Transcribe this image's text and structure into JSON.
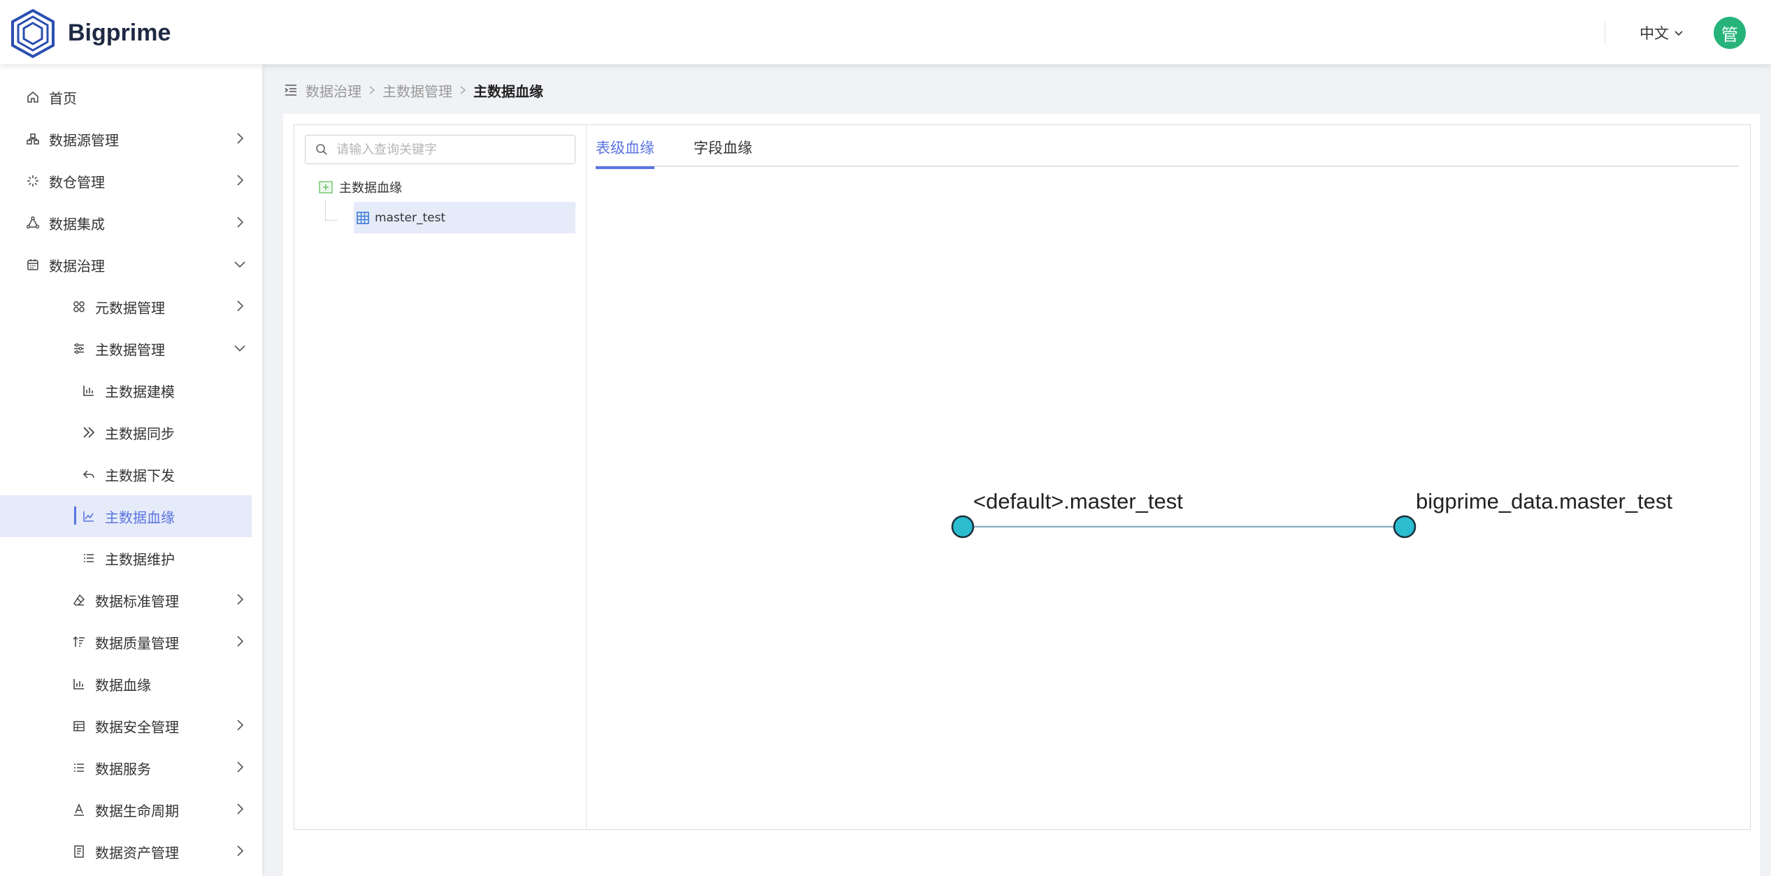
{
  "app": {
    "name": "Bigprime"
  },
  "header": {
    "language": "中文",
    "avatar_text": "管"
  },
  "sidebar": {
    "items": [
      {
        "label": "首页",
        "icon": "home-icon"
      },
      {
        "label": "数据源管理",
        "icon": "datasource-icon"
      },
      {
        "label": "数仓管理",
        "icon": "warehouse-icon"
      },
      {
        "label": "数据集成",
        "icon": "integration-icon"
      },
      {
        "label": "数据治理",
        "icon": "governance-icon"
      },
      {
        "label": "元数据管理",
        "icon": "metadata-icon"
      },
      {
        "label": "主数据管理",
        "icon": "masterdata-icon"
      },
      {
        "label": "主数据建模",
        "icon": "bar-chart-icon"
      },
      {
        "label": "主数据同步",
        "icon": "double-chevron-icon"
      },
      {
        "label": "主数据下发",
        "icon": "reply-icon"
      },
      {
        "label": "主数据血缘",
        "icon": "line-chart-icon"
      },
      {
        "label": "主数据维护",
        "icon": "list-icon"
      },
      {
        "label": "数据标准管理",
        "icon": "eraser-icon"
      },
      {
        "label": "数据质量管理",
        "icon": "sort-icon"
      },
      {
        "label": "数据血缘",
        "icon": "bar-chart-icon"
      },
      {
        "label": "数据安全管理",
        "icon": "table-icon"
      },
      {
        "label": "数据服务",
        "icon": "list-icon"
      },
      {
        "label": "数据生命周期",
        "icon": "text-a-icon"
      },
      {
        "label": "数据资产管理",
        "icon": "asset-icon"
      }
    ]
  },
  "breadcrumb": {
    "items": [
      "数据治理",
      "主数据管理",
      "主数据血缘"
    ]
  },
  "search": {
    "placeholder": "请输入查询关键字",
    "value": ""
  },
  "tree": {
    "root": "主数据血缘",
    "leaf": "master_test"
  },
  "tabs": [
    "表级血缘",
    "字段血缘"
  ],
  "graph": {
    "source": "<default>.master_test",
    "target": "bigprime_data.master_test",
    "node_color": "#2bbcd0",
    "edge_color": "#8fb0c8"
  },
  "colors": {
    "accent": "#5b74e0",
    "active_bg": "#e6ebfa",
    "avatar": "#26b47a"
  }
}
